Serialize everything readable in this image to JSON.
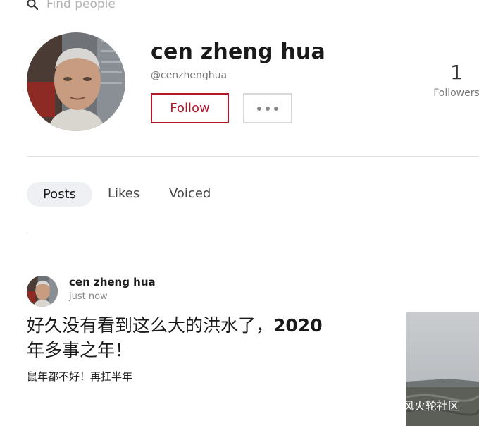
{
  "search": {
    "placeholder": "Find people",
    "icon": "search-icon"
  },
  "profile": {
    "name": "cen zheng hua",
    "handle": "@cenzhenghua",
    "follow_label": "Follow",
    "more_icon": "more-icon",
    "followers_count": "1",
    "followers_label": "Followers"
  },
  "tabs": [
    {
      "label": "Posts",
      "active": true
    },
    {
      "label": "Likes",
      "active": false
    },
    {
      "label": "Voiced",
      "active": false
    }
  ],
  "post": {
    "author": "cen zheng hua",
    "time": "just now",
    "title_part1": "好久没有看到这么大的洪水了，",
    "title_year": "2020",
    "title_part2": "年多事之年！",
    "subtitle": "鼠年都不好！再扛半年"
  },
  "watermark": {
    "text": "风火轮社区",
    "icon": "wechat-icon"
  },
  "colors": {
    "accent": "#b5162b",
    "tab_active_bg": "#eef0f4",
    "divider": "#e2e2e2"
  }
}
